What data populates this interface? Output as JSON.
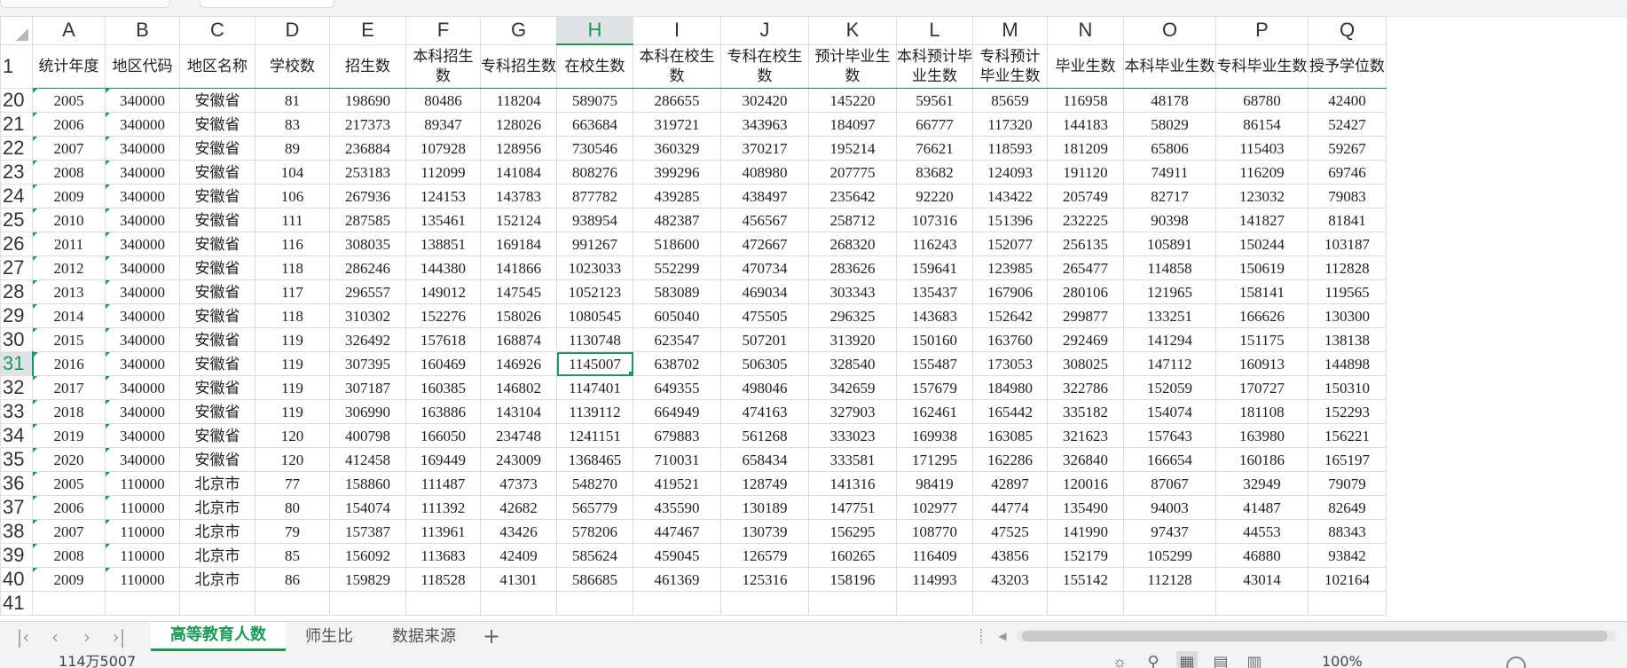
{
  "columns": [
    "A",
    "B",
    "C",
    "D",
    "E",
    "F",
    "G",
    "H",
    "I",
    "J",
    "K",
    "L",
    "M",
    "N",
    "O",
    "P",
    "Q"
  ],
  "selected_column": "H",
  "selected_row": "31",
  "header_row_number": "1",
  "headers": [
    "统计年度",
    "地区代码",
    "地区名称",
    "学校数",
    "招生数",
    "本科招生数",
    "专科招生数",
    "在校生数",
    "本科在校生数",
    "专科在校生数",
    "预计毕业生数",
    "本科预计毕业生数",
    "专科预计毕业生数",
    "毕业生数",
    "本科毕业生数",
    "专科毕业生数",
    "授予学位数"
  ],
  "rows": [
    {
      "n": "20",
      "cells": [
        "2005",
        "340000",
        "安徽省",
        "81",
        "198690",
        "80486",
        "118204",
        "589075",
        "286655",
        "302420",
        "145220",
        "59561",
        "85659",
        "116958",
        "48178",
        "68780",
        "42400"
      ]
    },
    {
      "n": "21",
      "cells": [
        "2006",
        "340000",
        "安徽省",
        "83",
        "217373",
        "89347",
        "128026",
        "663684",
        "319721",
        "343963",
        "184097",
        "66777",
        "117320",
        "144183",
        "58029",
        "86154",
        "52427"
      ]
    },
    {
      "n": "22",
      "cells": [
        "2007",
        "340000",
        "安徽省",
        "89",
        "236884",
        "107928",
        "128956",
        "730546",
        "360329",
        "370217",
        "195214",
        "76621",
        "118593",
        "181209",
        "65806",
        "115403",
        "59267"
      ]
    },
    {
      "n": "23",
      "cells": [
        "2008",
        "340000",
        "安徽省",
        "104",
        "253183",
        "112099",
        "141084",
        "808276",
        "399296",
        "408980",
        "207775",
        "83682",
        "124093",
        "191120",
        "74911",
        "116209",
        "69746"
      ]
    },
    {
      "n": "24",
      "cells": [
        "2009",
        "340000",
        "安徽省",
        "106",
        "267936",
        "124153",
        "143783",
        "877782",
        "439285",
        "438497",
        "235642",
        "92220",
        "143422",
        "205749",
        "82717",
        "123032",
        "79083"
      ]
    },
    {
      "n": "25",
      "cells": [
        "2010",
        "340000",
        "安徽省",
        "111",
        "287585",
        "135461",
        "152124",
        "938954",
        "482387",
        "456567",
        "258712",
        "107316",
        "151396",
        "232225",
        "90398",
        "141827",
        "81841"
      ]
    },
    {
      "n": "26",
      "cells": [
        "2011",
        "340000",
        "安徽省",
        "116",
        "308035",
        "138851",
        "169184",
        "991267",
        "518600",
        "472667",
        "268320",
        "116243",
        "152077",
        "256135",
        "105891",
        "150244",
        "103187"
      ]
    },
    {
      "n": "27",
      "cells": [
        "2012",
        "340000",
        "安徽省",
        "118",
        "286246",
        "144380",
        "141866",
        "1023033",
        "552299",
        "470734",
        "283626",
        "159641",
        "123985",
        "265477",
        "114858",
        "150619",
        "112828"
      ]
    },
    {
      "n": "28",
      "cells": [
        "2013",
        "340000",
        "安徽省",
        "117",
        "296557",
        "149012",
        "147545",
        "1052123",
        "583089",
        "469034",
        "303343",
        "135437",
        "167906",
        "280106",
        "121965",
        "158141",
        "119565"
      ]
    },
    {
      "n": "29",
      "cells": [
        "2014",
        "340000",
        "安徽省",
        "118",
        "310302",
        "152276",
        "158026",
        "1080545",
        "605040",
        "475505",
        "296325",
        "143683",
        "152642",
        "299877",
        "133251",
        "166626",
        "130300"
      ]
    },
    {
      "n": "30",
      "cells": [
        "2015",
        "340000",
        "安徽省",
        "119",
        "326492",
        "157618",
        "168874",
        "1130748",
        "623547",
        "507201",
        "313920",
        "150160",
        "163760",
        "292469",
        "141294",
        "151175",
        "138138"
      ]
    },
    {
      "n": "31",
      "cells": [
        "2016",
        "340000",
        "安徽省",
        "119",
        "307395",
        "160469",
        "146926",
        "1145007",
        "638702",
        "506305",
        "328540",
        "155487",
        "173053",
        "308025",
        "147112",
        "160913",
        "144898"
      ]
    },
    {
      "n": "32",
      "cells": [
        "2017",
        "340000",
        "安徽省",
        "119",
        "307187",
        "160385",
        "146802",
        "1147401",
        "649355",
        "498046",
        "342659",
        "157679",
        "184980",
        "322786",
        "152059",
        "170727",
        "150310"
      ]
    },
    {
      "n": "33",
      "cells": [
        "2018",
        "340000",
        "安徽省",
        "119",
        "306990",
        "163886",
        "143104",
        "1139112",
        "664949",
        "474163",
        "327903",
        "162461",
        "165442",
        "335182",
        "154074",
        "181108",
        "152293"
      ]
    },
    {
      "n": "34",
      "cells": [
        "2019",
        "340000",
        "安徽省",
        "120",
        "400798",
        "166050",
        "234748",
        "1241151",
        "679883",
        "561268",
        "333023",
        "169938",
        "163085",
        "321623",
        "157643",
        "163980",
        "156221"
      ]
    },
    {
      "n": "35",
      "cells": [
        "2020",
        "340000",
        "安徽省",
        "120",
        "412458",
        "169449",
        "243009",
        "1368465",
        "710031",
        "658434",
        "333581",
        "171295",
        "162286",
        "326840",
        "166654",
        "160186",
        "165197"
      ]
    },
    {
      "n": "36",
      "cells": [
        "2005",
        "110000",
        "北京市",
        "77",
        "158860",
        "111487",
        "47373",
        "548270",
        "419521",
        "128749",
        "141316",
        "98419",
        "42897",
        "120016",
        "87067",
        "32949",
        "79079"
      ]
    },
    {
      "n": "37",
      "cells": [
        "2006",
        "110000",
        "北京市",
        "80",
        "154074",
        "111392",
        "42682",
        "565779",
        "435590",
        "130189",
        "147751",
        "102977",
        "44774",
        "135490",
        "94003",
        "41487",
        "82649"
      ]
    },
    {
      "n": "38",
      "cells": [
        "2007",
        "110000",
        "北京市",
        "79",
        "157387",
        "113961",
        "43426",
        "578206",
        "447467",
        "130739",
        "156295",
        "108770",
        "47525",
        "141990",
        "97437",
        "44553",
        "88343"
      ]
    },
    {
      "n": "39",
      "cells": [
        "2008",
        "110000",
        "北京市",
        "85",
        "156092",
        "113683",
        "42409",
        "585624",
        "459045",
        "126579",
        "160265",
        "116409",
        "43856",
        "152179",
        "105299",
        "46880",
        "93842"
      ]
    },
    {
      "n": "40",
      "cells": [
        "2009",
        "110000",
        "北京市",
        "86",
        "159829",
        "118528",
        "41301",
        "586685",
        "461369",
        "125316",
        "158196",
        "114993",
        "43203",
        "155142",
        "112128",
        "43014",
        "102164"
      ]
    }
  ],
  "partial_row_number": "41",
  "sheet_tabs": [
    "高等教育人数",
    "师生比",
    "数据来源"
  ],
  "active_sheet_index": 0,
  "add_sheet_label": "+",
  "nav_buttons": [
    "|‹",
    "‹",
    "›",
    "›|"
  ],
  "status_text": "114万5007",
  "zoom_text": "100%",
  "colors": {
    "accent": "#1a9a55",
    "gridline": "#d9d9e8",
    "header_bg": "#dfe2e6"
  }
}
